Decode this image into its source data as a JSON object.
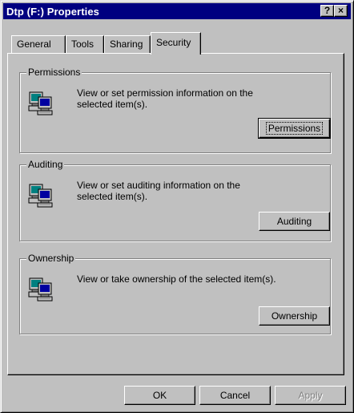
{
  "window": {
    "title": "Dtp (F:) Properties",
    "help_glyph": "?",
    "close_glyph": "×"
  },
  "tabs": [
    {
      "label": "General",
      "active": false
    },
    {
      "label": "Tools",
      "active": false
    },
    {
      "label": "Sharing",
      "active": false
    },
    {
      "label": "Security",
      "active": true
    }
  ],
  "groups": {
    "permissions": {
      "legend": "Permissions",
      "description": "View or set permission information on the selected item(s).",
      "button_label": "Permissions",
      "icon": "computer-icon"
    },
    "auditing": {
      "legend": "Auditing",
      "description": "View or set auditing information on the selected item(s).",
      "button_label": "Auditing",
      "icon": "computer-icon"
    },
    "ownership": {
      "legend": "Ownership",
      "description": "View or take ownership of the selected item(s).",
      "button_label": "Ownership",
      "icon": "computer-icon"
    }
  },
  "footer": {
    "ok_label": "OK",
    "cancel_label": "Cancel",
    "apply_label": "Apply",
    "apply_disabled": true
  },
  "colors": {
    "titlebar": "#000080",
    "face": "#c0c0c0",
    "shadow": "#808080",
    "highlight": "#ffffff"
  }
}
